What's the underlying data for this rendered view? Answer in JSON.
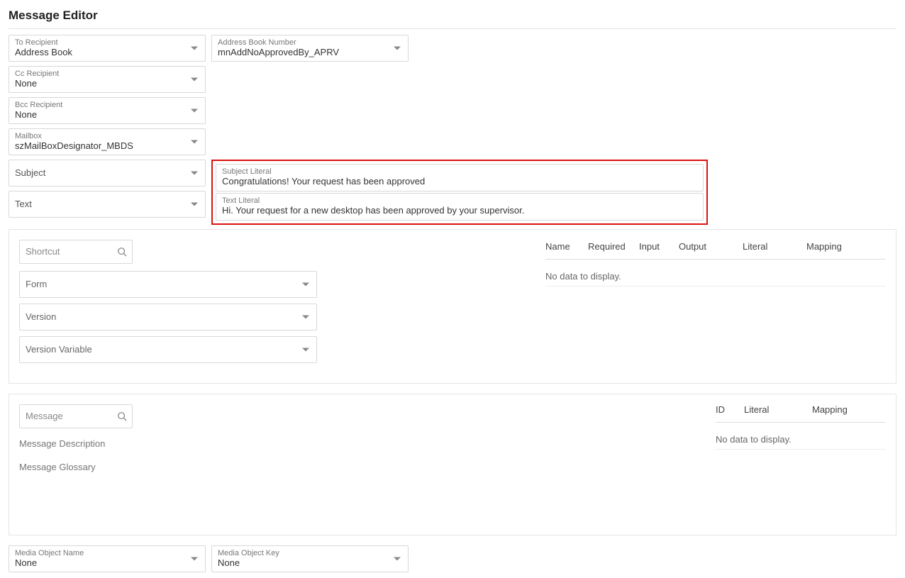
{
  "title": "Message Editor",
  "fields": {
    "to": {
      "label": "To Recipient",
      "value": "Address Book"
    },
    "abn": {
      "label": "Address Book Number",
      "value": "mnAddNoApprovedBy_APRV"
    },
    "cc": {
      "label": "Cc Recipient",
      "value": "None"
    },
    "bcc": {
      "label": "Bcc Recipient",
      "value": "None"
    },
    "mailbox": {
      "label": "Mailbox",
      "value": "szMailBoxDesignator_MBDS"
    },
    "subject": {
      "value": "Subject"
    },
    "text": {
      "value": "Text"
    },
    "subjectLiteral": {
      "label": "Subject Literal",
      "value": "Congratulations! Your request has been approved"
    },
    "textLiteral": {
      "label": "Text Literal",
      "value": "Hi. Your request for a new desktop has been approved by your supervisor."
    }
  },
  "panel1": {
    "search_placeholder": "Shortcut",
    "form": "Form",
    "version": "Version",
    "versionVar": "Version Variable",
    "cols": [
      "Name",
      "Required",
      "Input",
      "Output",
      "Literal",
      "Mapping"
    ],
    "nodata": "No data to display."
  },
  "panel2": {
    "search_placeholder": "Message",
    "desc": "Message Description",
    "glossary": "Message Glossary",
    "cols": [
      "ID",
      "Literal",
      "Mapping"
    ],
    "nodata": "No data to display."
  },
  "bottom": {
    "mon": {
      "label": "Media Object Name",
      "value": "None"
    },
    "mok": {
      "label": "Media Object Key",
      "value": "None"
    }
  }
}
